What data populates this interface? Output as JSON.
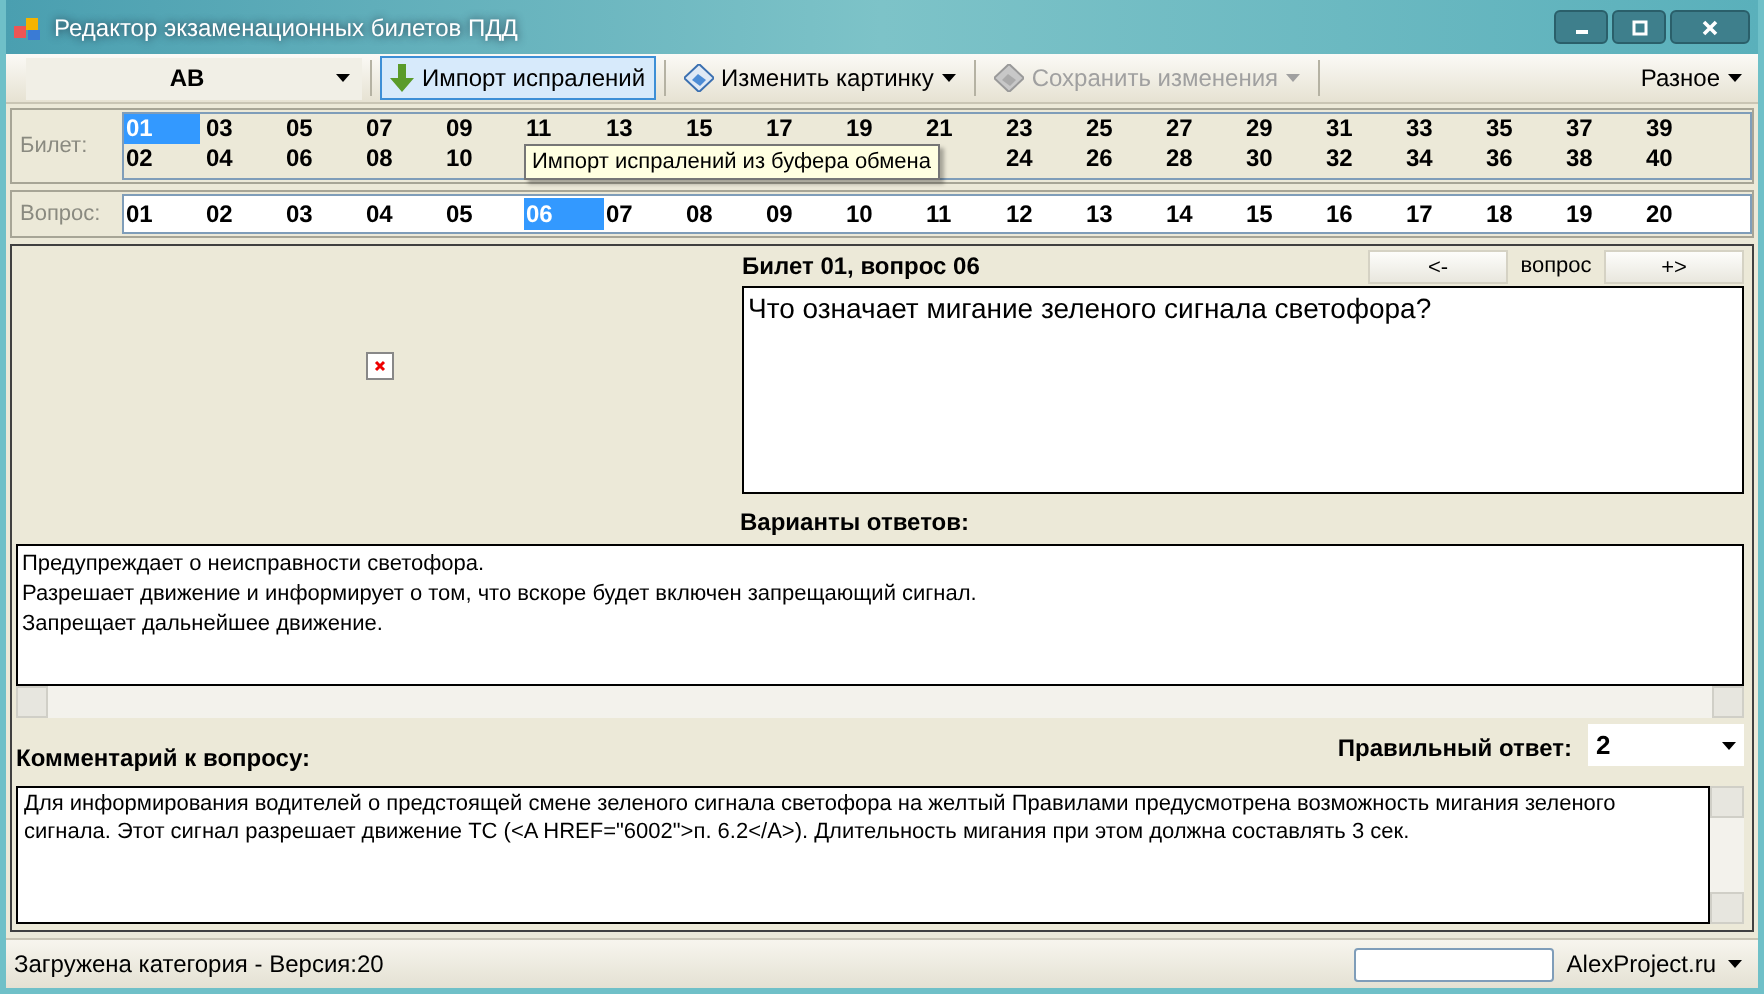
{
  "window": {
    "title": "Редактор экзаменационных билетов ПДД"
  },
  "toolbar": {
    "category": {
      "value": "AB"
    },
    "buttons": [
      {
        "label": "Импорт испралений",
        "kind": "import",
        "dropdown": false,
        "disabled": false,
        "selected": true
      },
      {
        "label": "Изменить картинку",
        "kind": "picture",
        "dropdown": true,
        "disabled": false,
        "selected": false
      },
      {
        "label": "Сохранить изменения",
        "kind": "picture",
        "dropdown": true,
        "disabled": true,
        "selected": false
      }
    ],
    "menu": {
      "label": "Разное"
    }
  },
  "tickets": {
    "label": "Билет:",
    "columns": [
      {
        "top": {
          "label": "01",
          "selected": true
        },
        "bottom": {
          "label": "02",
          "selected": false
        }
      },
      {
        "top": {
          "label": "03",
          "selected": false
        },
        "bottom": {
          "label": "04",
          "selected": false
        }
      },
      {
        "top": {
          "label": "05",
          "selected": false
        },
        "bottom": {
          "label": "06",
          "selected": false
        }
      },
      {
        "top": {
          "label": "07",
          "selected": false
        },
        "bottom": {
          "label": "08",
          "selected": false
        }
      },
      {
        "top": {
          "label": "09",
          "selected": false
        },
        "bottom": {
          "label": "10",
          "selected": false
        }
      },
      {
        "top": {
          "label": "11",
          "selected": false
        }
      },
      {
        "top": {
          "label": "13",
          "selected": false
        }
      },
      {
        "top": {
          "label": "15",
          "selected": false
        }
      },
      {
        "top": {
          "label": "17",
          "selected": false
        }
      },
      {
        "top": {
          "label": "19",
          "selected": false
        }
      },
      {
        "top": {
          "label": "21",
          "selected": false
        }
      },
      {
        "top": {
          "label": "23",
          "selected": false
        },
        "bottom": {
          "label": "24",
          "selected": false
        }
      },
      {
        "top": {
          "label": "25",
          "selected": false
        },
        "bottom": {
          "label": "26",
          "selected": false
        }
      },
      {
        "top": {
          "label": "27",
          "selected": false
        },
        "bottom": {
          "label": "28",
          "selected": false
        }
      },
      {
        "top": {
          "label": "29",
          "selected": false
        },
        "bottom": {
          "label": "30",
          "selected": false
        }
      },
      {
        "top": {
          "label": "31",
          "selected": false
        },
        "bottom": {
          "label": "32",
          "selected": false
        }
      },
      {
        "top": {
          "label": "33",
          "selected": false
        },
        "bottom": {
          "label": "34",
          "selected": false
        }
      },
      {
        "top": {
          "label": "35",
          "selected": false
        },
        "bottom": {
          "label": "36",
          "selected": false
        }
      },
      {
        "top": {
          "label": "37",
          "selected": false
        },
        "bottom": {
          "label": "38",
          "selected": false
        }
      },
      {
        "top": {
          "label": "39",
          "selected": false
        },
        "bottom": {
          "label": "40",
          "selected": false
        }
      }
    ]
  },
  "tooltip": {
    "text": "Импорт испралений из буфера обмена"
  },
  "questions": {
    "label": "Вопрос:",
    "items": [
      {
        "label": "01",
        "selected": false
      },
      {
        "label": "02",
        "selected": false
      },
      {
        "label": "03",
        "selected": false
      },
      {
        "label": "04",
        "selected": false
      },
      {
        "label": "05",
        "selected": false
      },
      {
        "label": "06",
        "selected": true
      },
      {
        "label": "07",
        "selected": false
      },
      {
        "label": "08",
        "selected": false
      },
      {
        "label": "09",
        "selected": false
      },
      {
        "label": "10",
        "selected": false
      },
      {
        "label": "11",
        "selected": false
      },
      {
        "label": "12",
        "selected": false
      },
      {
        "label": "13",
        "selected": false
      },
      {
        "label": "14",
        "selected": false
      },
      {
        "label": "15",
        "selected": false
      },
      {
        "label": "16",
        "selected": false
      },
      {
        "label": "17",
        "selected": false
      },
      {
        "label": "18",
        "selected": false
      },
      {
        "label": "19",
        "selected": false
      },
      {
        "label": "20",
        "selected": false
      }
    ]
  },
  "editor": {
    "heading": "Билет 01, вопрос 06",
    "nav": {
      "prev": "<-",
      "label": "вопрос",
      "next": "+>"
    },
    "question": "Что означает мигание зеленого сигнала светофора?",
    "answers_label": "Варианты ответов:",
    "answers": [
      "Предупреждает о неисправности светофора.",
      "Разрешает движение и информирует о том, что вскоре будет включен запрещающий сигнал.",
      "Запрещает дальнейшее движение."
    ],
    "comment_label": "Комментарий к вопросу:",
    "correct_label": "Правильный ответ:",
    "correct_value": "2",
    "comment": "Для информирования водителей о предстоящей смене зеленого сигнала светофора на желтый Правилами предусмотрена возможность мигания зеленого сигнала. Этот сигнал разрешает движение ТС (<A HREF=\"6002\">п. 6.2</A>). Длительность мигания при этом должна составлять 3 сек."
  },
  "status_bar": {
    "text": "Загружена категория - Версия:20",
    "link": "AlexProject.ru"
  }
}
